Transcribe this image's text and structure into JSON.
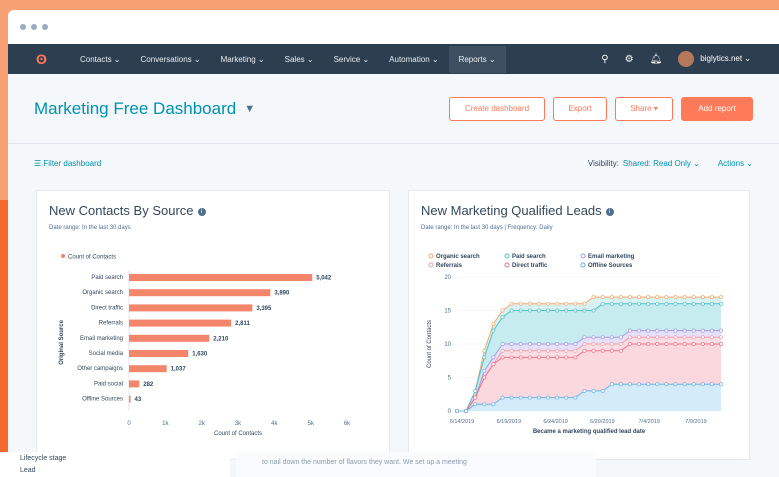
{
  "nav": {
    "items": [
      "Contacts ⌄",
      "Conversations ⌄",
      "Marketing ⌄",
      "Sales ⌄",
      "Service ⌄",
      "Automation ⌄",
      "Reports ⌄"
    ],
    "account": "biglytics.net ⌄"
  },
  "header": {
    "title": "Marketing Free Dashboard",
    "create_label": "Create dashboard",
    "export_label": "Export",
    "share_label": "Share ▾",
    "add_report_label": "Add report"
  },
  "filterbar": {
    "filter_label": "☰  Filter dashboard",
    "visibility_label": "Visibility:",
    "visibility_value": "Shared: Read Only ⌄",
    "actions_label": "Actions ⌄"
  },
  "card1": {
    "title": "New Contacts By Source",
    "subtitle": "Date range: In the last 30 days",
    "chart_data": {
      "type": "bar",
      "orientation": "horizontal",
      "legend": [
        "Count of Contacts"
      ],
      "categories": [
        "Paid search",
        "Organic search",
        "Direct traffic",
        "Referrals",
        "Email marketing",
        "Social media",
        "Other campaigns",
        "Paid social",
        "Offline Sources"
      ],
      "values": [
        5042,
        3890,
        3395,
        2811,
        2210,
        1630,
        1037,
        282,
        43
      ],
      "value_labels": [
        "5,042",
        "3,890",
        "3,395",
        "2,811",
        "2,210",
        "1,630",
        "1,037",
        "282",
        "43"
      ],
      "xticks": [
        "0",
        "1k",
        "2k",
        "3k",
        "4k",
        "5k",
        "6k"
      ],
      "xlim": [
        0,
        6000
      ],
      "xlabel": "Count of Contacts",
      "ylabel": "Original Source",
      "color": "#f2856a"
    }
  },
  "card2": {
    "title": "New Marketing Qualified Leads",
    "subtitle": "Date range: In the last 30 days  |  Frequency: Daily",
    "chart_data": {
      "type": "area",
      "stacked": true,
      "legend": [
        {
          "name": "Organic search",
          "color": "#f5a86e"
        },
        {
          "name": "Paid search",
          "color": "#4fc2c9"
        },
        {
          "name": "Email marketing",
          "color": "#a59ae6"
        },
        {
          "name": "Referrals",
          "color": "#f59aa8"
        },
        {
          "name": "Direct traffic",
          "color": "#f07088"
        },
        {
          "name": "Offline Sources",
          "color": "#6ab3e8"
        }
      ],
      "xticks": [
        "6/14/2019",
        "6/19/2019",
        "6/24/2019",
        "6/29/2019",
        "7/4/2019",
        "7/9/2019"
      ],
      "yticks": [
        "0",
        "5",
        "10",
        "15",
        "20"
      ],
      "ylim": [
        0,
        20
      ],
      "xlabel": "Became a marketing qualified lead date",
      "ylabel": "Count of Contacts",
      "x_count": 30,
      "lines": [
        {
          "name": "Organic search",
          "color": "#f5a86e",
          "values": [
            0,
            0,
            3,
            9,
            13,
            15,
            16,
            16,
            16,
            16,
            16,
            16,
            16,
            16,
            16,
            17,
            17,
            17,
            17,
            17,
            17,
            17,
            17,
            17,
            17,
            17,
            17,
            17,
            17,
            17
          ]
        },
        {
          "name": "Paid search",
          "color": "#4fc2c9",
          "values": [
            0,
            0,
            3,
            8,
            12,
            14,
            15,
            15,
            15,
            15,
            15,
            15,
            15,
            15,
            15,
            15,
            16,
            16,
            16,
            16,
            16,
            16,
            16,
            16,
            16,
            16,
            16,
            16,
            16,
            16
          ]
        },
        {
          "name": "Email marketing",
          "color": "#a59ae6",
          "values": [
            0,
            0,
            2,
            6,
            8,
            10,
            10,
            10,
            10,
            10,
            10,
            10,
            10,
            10,
            11,
            11,
            11,
            11,
            11,
            12,
            12,
            12,
            12,
            12,
            12,
            12,
            12,
            12,
            12,
            12
          ]
        },
        {
          "name": "Referrals",
          "color": "#f59aa8",
          "values": [
            0,
            0,
            2,
            5,
            7,
            9,
            9,
            9,
            9,
            9,
            9,
            9,
            9,
            9,
            10,
            10,
            10,
            10,
            10,
            11,
            11,
            11,
            11,
            11,
            11,
            11,
            11,
            11,
            11,
            11
          ]
        },
        {
          "name": "Direct traffic",
          "color": "#f07088",
          "values": [
            0,
            0,
            2,
            5,
            7,
            8,
            8,
            8,
            8,
            8,
            8,
            8,
            8,
            8,
            9,
            9,
            9,
            9,
            9,
            10,
            10,
            10,
            10,
            10,
            10,
            10,
            10,
            10,
            10,
            10
          ]
        },
        {
          "name": "Offline Sources",
          "color": "#6ab3e8",
          "values": [
            0,
            0,
            1,
            1,
            1,
            2,
            2,
            2,
            2,
            2,
            2,
            2,
            2,
            2,
            3,
            3,
            3,
            4,
            4,
            4,
            4,
            4,
            4,
            4,
            4,
            4,
            4,
            4,
            4,
            4
          ]
        }
      ]
    }
  },
  "lower": {
    "lifecycle": "Lifecycle stage",
    "lead": "Lead",
    "snippet": "to nail down the number of flavors they want. We set up a meeting"
  }
}
